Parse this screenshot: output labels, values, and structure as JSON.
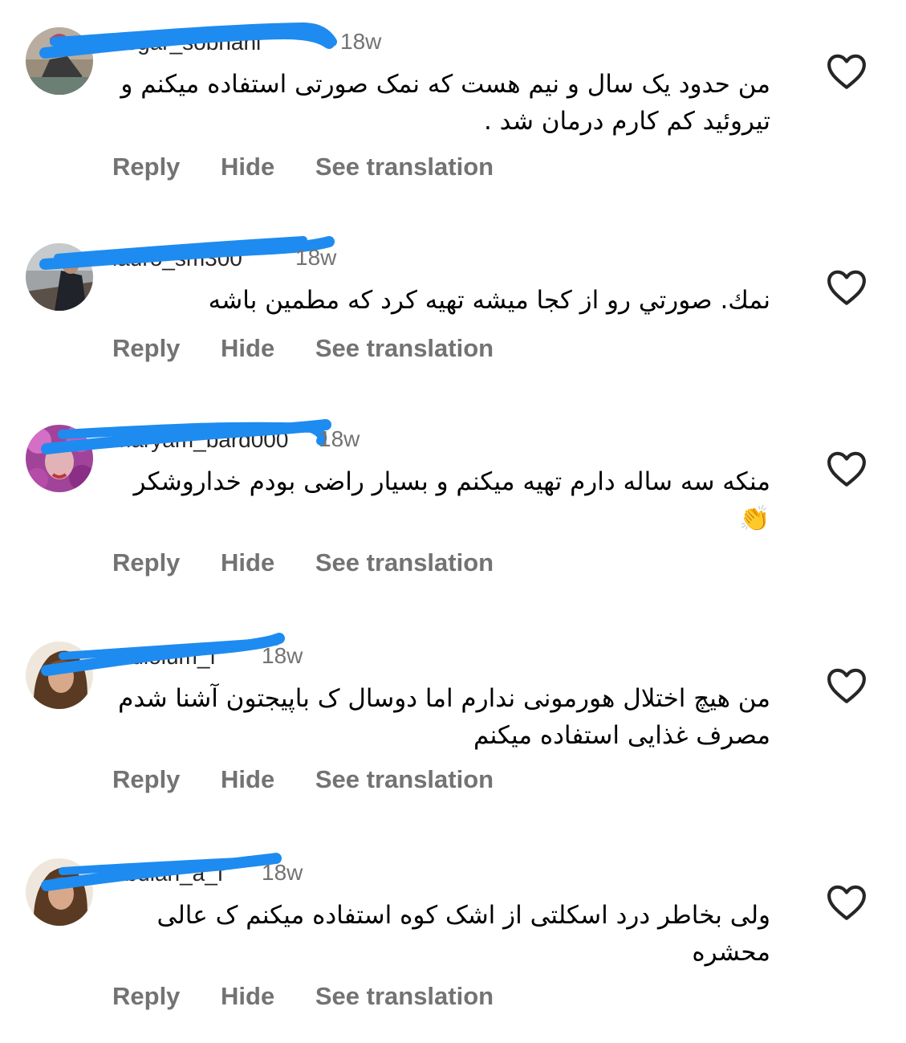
{
  "comments": [
    {
      "username": "negar_sobhani",
      "time": "18w",
      "text": "من حدود یک سال و نیم هست که نمک صورتی استفاده میکنم و تیروئید کم کارم درمان شد .",
      "reply": "Reply",
      "hide": "Hide",
      "translate": "See translation",
      "like_icon": "heart-outline-icon"
    },
    {
      "username": "lauro_sm300",
      "time": "18w",
      "text": "نمك. صورتي رو از كجا ميشه تهيه كرد  كه مطمين باشه",
      "reply": "Reply",
      "hide": "Hide",
      "translate": "See translation",
      "like_icon": "heart-outline-icon"
    },
    {
      "username": "maryam_bard000",
      "time": "18w",
      "text": "منکه سه ساله دارم تهیه میکنم و بسیار راضی بودم خداروشکر👏",
      "reply": "Reply",
      "hide": "Hide",
      "translate": "See translation",
      "like_icon": "heart-outline-icon"
    },
    {
      "username": "atdiolum_f",
      "time": "18w",
      "text": "من هیچ اختلال هورمونی ندارم اما دوسال ک باپیجتون آشنا شدم مصرف غذایی استفاده میکنم",
      "reply": "Reply",
      "hide": "Hide",
      "translate": "See translation",
      "like_icon": "heart-outline-icon"
    },
    {
      "username": "abdiah_a_f",
      "time": "18w",
      "text": "ولی بخاطر درد اسکلتی از اشک کوه استفاده میکنم ک عالی محشره",
      "reply": "Reply",
      "hide": "Hide",
      "translate": "See translation",
      "like_icon": "heart-outline-icon"
    }
  ],
  "colors": {
    "redaction": "#1E8BF0",
    "secondary_text": "#737373",
    "primary_text": "#000000",
    "icon": "#262626"
  }
}
